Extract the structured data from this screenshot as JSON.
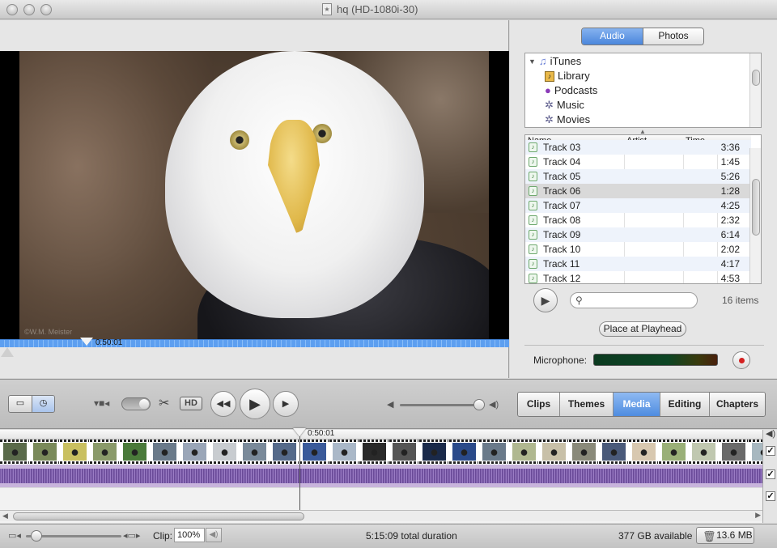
{
  "window": {
    "title": "hq (HD-1080i-30)"
  },
  "viewer": {
    "timecode": "0:50:01",
    "watermark": "©W.M. Meister"
  },
  "media_pane": {
    "segments": [
      {
        "label": "Audio",
        "active": true
      },
      {
        "label": "Photos",
        "active": false
      }
    ],
    "tree": [
      {
        "label": "iTunes",
        "icon": "itunes-icon"
      },
      {
        "label": "Library",
        "icon": "library-icon"
      },
      {
        "label": "Podcasts",
        "icon": "podcast-icon"
      },
      {
        "label": "Music",
        "icon": "playlist-icon"
      },
      {
        "label": "Movies",
        "icon": "playlist-icon"
      }
    ],
    "columns": {
      "name": "Name",
      "artist": "Artist",
      "time": "Time"
    },
    "tracks": [
      {
        "name": "Track 03",
        "artist": "",
        "time": "3:36"
      },
      {
        "name": "Track 04",
        "artist": "",
        "time": "1:45"
      },
      {
        "name": "Track 05",
        "artist": "",
        "time": "5:26"
      },
      {
        "name": "Track 06",
        "artist": "",
        "time": "1:28",
        "selected": true
      },
      {
        "name": "Track 07",
        "artist": "",
        "time": "4:25"
      },
      {
        "name": "Track 08",
        "artist": "",
        "time": "2:32"
      },
      {
        "name": "Track 09",
        "artist": "",
        "time": "6:14"
      },
      {
        "name": "Track 10",
        "artist": "",
        "time": "2:02"
      },
      {
        "name": "Track 11",
        "artist": "",
        "time": "4:17"
      },
      {
        "name": "Track 12",
        "artist": "",
        "time": "4:53"
      }
    ],
    "search_placeholder": "",
    "item_count": "16 items",
    "place_button": "Place at Playhead",
    "microphone_label": "Microphone:"
  },
  "toolbar": {
    "hd_label": "HD",
    "tabs": [
      {
        "label": "Clips",
        "active": false
      },
      {
        "label": "Themes",
        "active": false
      },
      {
        "label": "Media",
        "active": true
      },
      {
        "label": "Editing",
        "active": false
      },
      {
        "label": "Chapters",
        "active": false
      }
    ]
  },
  "timeline": {
    "timecode": "0:50:01",
    "clip_count": 26
  },
  "status": {
    "clip_label": "Clip:",
    "clip_volume": "100%",
    "duration": "5:15:09 total duration",
    "available": "377 GB available",
    "trash_size": "13.6 MB"
  }
}
